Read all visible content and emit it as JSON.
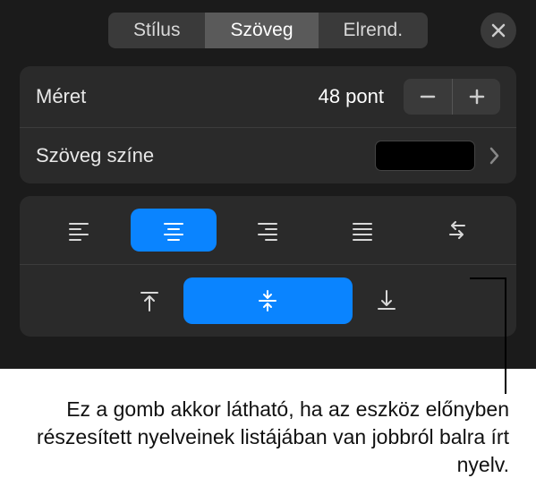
{
  "tabs": {
    "t1": "Stílus",
    "t2": "Szöveg",
    "t3": "Elrend."
  },
  "size": {
    "label": "Méret",
    "value": "48 pont"
  },
  "textColor": {
    "label": "Szöveg színe",
    "swatch": "#000000"
  },
  "icons": {
    "close": "close-icon",
    "minus": "minus-icon",
    "plus": "plus-icon",
    "chevron": "chevron-right-icon",
    "alignLeft": "align-left-icon",
    "alignCenter": "align-center-icon",
    "alignRight": "align-right-icon",
    "alignJustify": "align-justify-icon",
    "rtl": "rtl-direction-icon",
    "valignTop": "valign-top-icon",
    "valignMiddle": "valign-middle-icon",
    "valignBottom": "valign-bottom-icon"
  },
  "caption": "Ez a gomb akkor látható, ha az eszköz előnyben részesített nyelveinek listájában van jobbról balra írt nyelv."
}
